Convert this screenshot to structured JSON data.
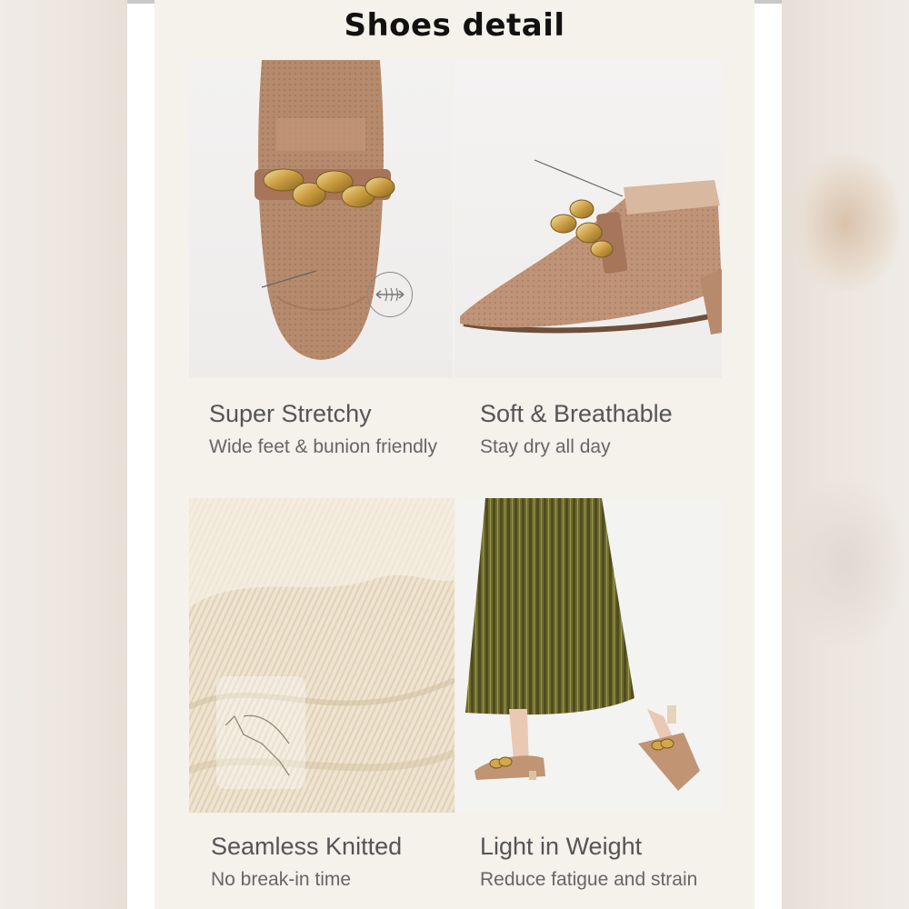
{
  "page": {
    "title": "Shoes detail"
  },
  "features": [
    {
      "title": "Super Stretchy",
      "subtitle": "Wide feet & bunion friendly"
    },
    {
      "title": "Soft & Breathable",
      "subtitle": "Stay dry all day"
    },
    {
      "title": "Seamless Knitted",
      "subtitle": "No break-in time"
    },
    {
      "title": "Light in Weight",
      "subtitle": "Reduce fatigue and strain"
    }
  ],
  "colors": {
    "card_background": "#f5f1eb",
    "shoe_knit": "#b98b6e",
    "gold_chain": "#c8a24e",
    "skirt_green": "#6b6a2c",
    "text_gray": "#555555"
  },
  "icons": [
    "stretch-icon",
    "breathable-icon",
    "shoe-outline-icon"
  ]
}
